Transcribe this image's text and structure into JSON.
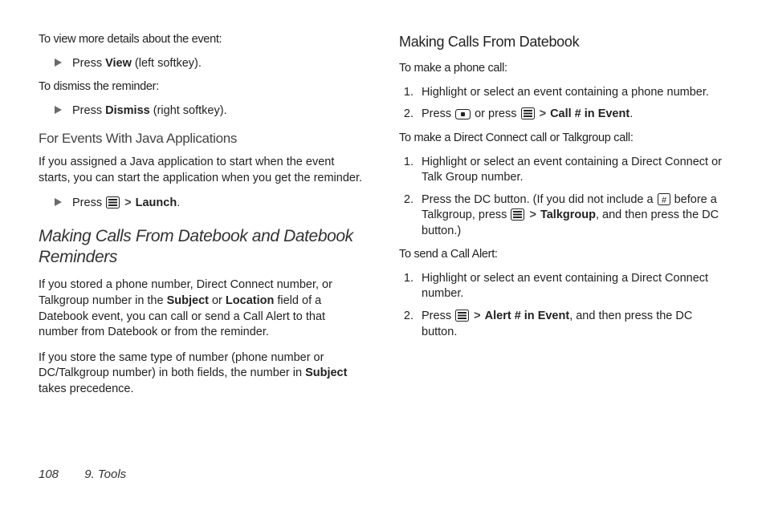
{
  "footer": {
    "page": "108",
    "chapter": "9. Tools"
  },
  "left": {
    "p1": "To view more details about the event:",
    "b1_pre": "Press ",
    "b1_bold": "View",
    "b1_post": " (left softkey).",
    "p2": "To dismiss the reminder:",
    "b2_pre": "Press ",
    "b2_bold": "Dismiss",
    "b2_post": " (right softkey).",
    "h_java": "For Events With Java Applications",
    "p_java": "If you assigned a Java application to start when the event starts, you can start the application when you get the reminder.",
    "b3_pre": "Press ",
    "b3_gt": ">",
    "b3_bold": "Launch",
    "b3_post": ".",
    "h_section": "Making Calls From Datebook and Datebook Reminders",
    "p_sec1a": "If you stored a phone number, Direct Connect number, or Talkgroup number in the ",
    "p_sec1_b1": "Subject",
    "p_sec1b": " or ",
    "p_sec1_b2": "Location",
    "p_sec1c": " field of a Datebook event, you can call or send a Call Alert to that number from Datebook or from the reminder.",
    "p_sec2a": "If you store the same type of number (phone number or DC/Talkgroup number) in both fields, the number in ",
    "p_sec2_b": "Subject",
    "p_sec2b": " takes precedence."
  },
  "right": {
    "h": "Making Calls From Datebook",
    "p1": "To make a phone call:",
    "l1_1": "Highlight or select an event containing a phone number.",
    "l1_2a": "Press ",
    "l1_2b": " or press ",
    "l1_2_gt": ">",
    "l1_2_bold": "Call # in Event",
    "l1_2c": ".",
    "p2": "To make a Direct Connect call or Talkgroup call:",
    "l2_1": "Highlight or select an event containing a Direct Connect or Talk Group number.",
    "l2_2a": "Press the DC button. (If you did not include a ",
    "l2_2b": " before a Talkgroup, press ",
    "l2_2_gt": ">",
    "l2_2_bold": "Talkgroup",
    "l2_2c": ", and then press the DC button.)",
    "p3": "To send a Call Alert:",
    "l3_1": "Highlight or select an event containing a Direct Connect number.",
    "l3_2a": "Press ",
    "l3_2_gt": ">",
    "l3_2_bold": "Alert # in Event",
    "l3_2b": ", and then press the DC button."
  }
}
